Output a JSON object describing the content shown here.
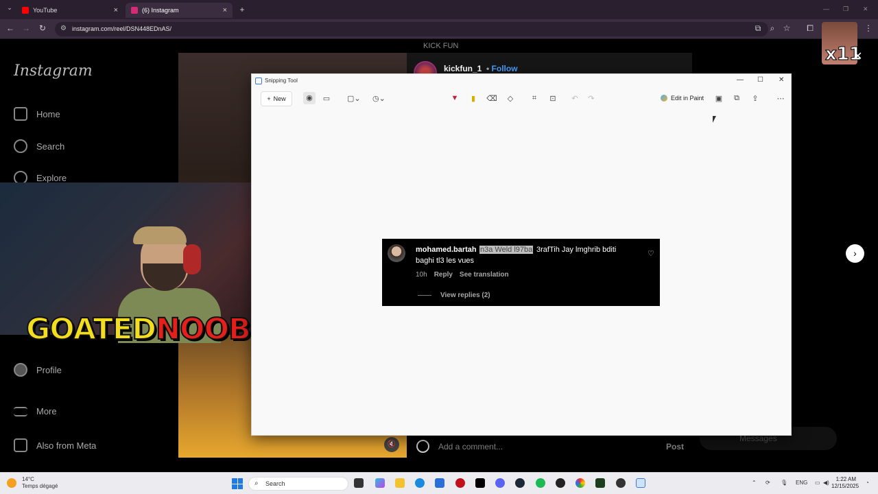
{
  "browser": {
    "tabs": [
      {
        "label": "YouTube",
        "active": false,
        "color": "#ff0000"
      },
      {
        "label": "(6) Instagram",
        "active": true,
        "color": "#d62976"
      }
    ],
    "new_tab": "+",
    "url": "instagram.com/reel/DSN448EDnAS/"
  },
  "instagram": {
    "logo": "Instagram",
    "nav": [
      {
        "label": "Home",
        "icon": "home-icon"
      },
      {
        "label": "Search",
        "icon": "search-icon"
      },
      {
        "label": "Explore",
        "icon": "compass-icon"
      },
      {
        "label": "Profile",
        "icon": "profile-icon"
      },
      {
        "label": "More",
        "icon": "menu-icon"
      },
      {
        "label": "Also from Meta",
        "icon": "meta-icon"
      }
    ],
    "page_header": "KICK FUN",
    "account": "kickfun_1",
    "dot": "•",
    "follow": "Follow",
    "add_comment_placeholder": "Add a comment...",
    "post": "Post",
    "messages": "Messages"
  },
  "overlay": {
    "brand_part1": "GOATED",
    "brand_part2": "NOOBIE",
    "badge": "x11"
  },
  "snipping_tool": {
    "title": "Snipping Tool",
    "new_label": "New",
    "edit_in_paint": "Edit in Paint",
    "more": "⋯"
  },
  "comment": {
    "username": "mohamed.bartah",
    "highlighted": "n3a Weld l97ba",
    "text_line1": "3rafTih Jay lmghrib bditi",
    "text_line2": "baghi tl3 les vues",
    "time": "10h",
    "reply": "Reply",
    "see_translation": "See translation",
    "view_replies": "View replies (2)"
  },
  "taskbar": {
    "temperature": "14°C",
    "weather": "Temps dégagé",
    "search": "Search",
    "language": "ENG",
    "time": "1:22 AM",
    "date": "12/15/2025"
  }
}
